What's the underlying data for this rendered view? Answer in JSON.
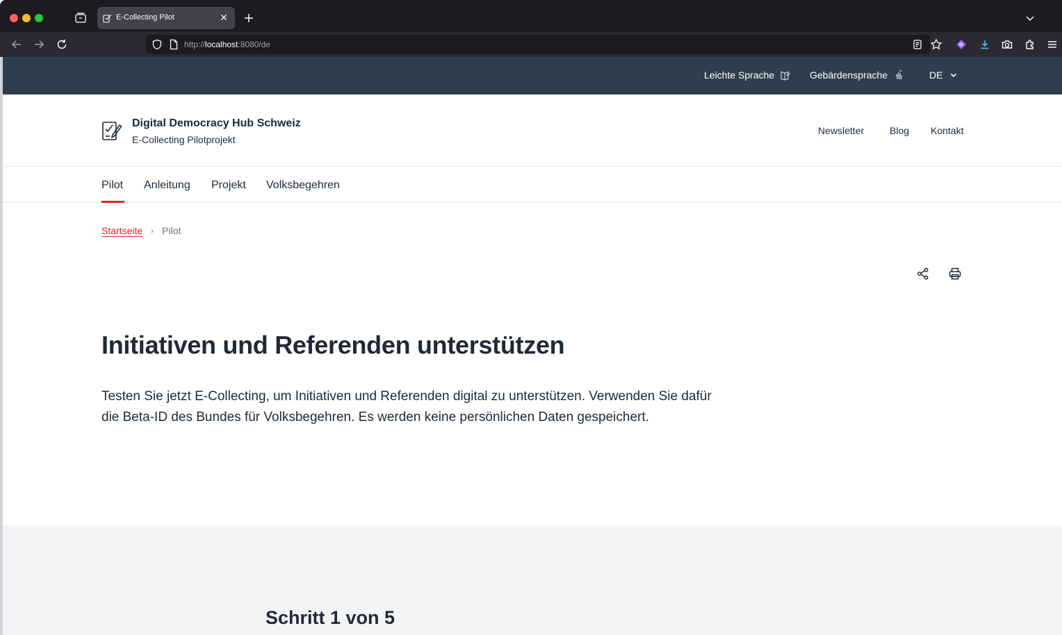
{
  "browser": {
    "tab_title": "E-Collecting Pilot",
    "url_prefix": "http://",
    "url_host": "localhost",
    "url_rest": ":8080/de"
  },
  "utility": {
    "easy_language": "Leichte Sprache",
    "sign_language": "Gebärdensprache",
    "language": "DE"
  },
  "header": {
    "brand_title": "Digital Democracy Hub Schweiz",
    "brand_subtitle": "E-Collecting Pilotprojekt",
    "meta_links": [
      "Newsletter",
      "Blog",
      "Kontakt"
    ]
  },
  "main_nav": {
    "items": [
      "Pilot",
      "Anleitung",
      "Projekt",
      "Volksbegehren"
    ],
    "active": "Pilot"
  },
  "breadcrumb": {
    "home": "Startseite",
    "separator": "›",
    "current": "Pilot"
  },
  "content": {
    "title": "Initiativen und Referenden unterstützen",
    "lead": "Testen Sie jetzt E-Collecting, um Initiativen und Referenden digital zu unterstützen. Verwenden Sie dafür die Beta-ID des Bundes für Volksbegehren. Es werden keine persönlichen Daten gespeichert."
  },
  "stepper": {
    "title": "Schritt 1 von 5"
  },
  "colors": {
    "accent": "#d8232a",
    "utility_bar": "#2f3e4e",
    "grey_section": "#f3f4f6"
  }
}
